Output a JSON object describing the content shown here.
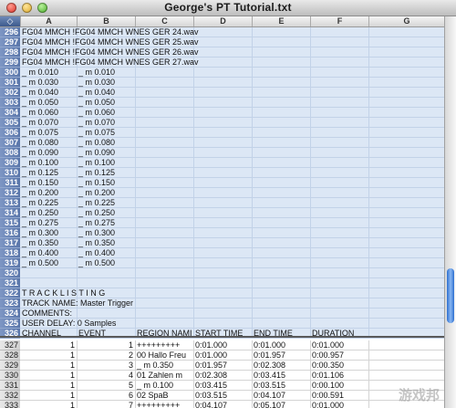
{
  "window": {
    "title": "George's PT Tutorial.txt"
  },
  "columns": [
    "A",
    "B",
    "C",
    "D",
    "E",
    "F",
    "G"
  ],
  "corner_symbol": "◇",
  "rows": [
    {
      "num": "296",
      "cells": [
        "FG04 MMCH !FG04 MMCH WNES GER 24.wav",
        "",
        "",
        "",
        "",
        "",
        ""
      ]
    },
    {
      "num": "297",
      "cells": [
        "FG04 MMCH !FG04 MMCH WNES GER 25.wav",
        "",
        "",
        "",
        "",
        "",
        ""
      ]
    },
    {
      "num": "298",
      "cells": [
        "FG04 MMCH !FG04 MMCH WNES GER 26.wav",
        "",
        "",
        "",
        "",
        "",
        ""
      ]
    },
    {
      "num": "299",
      "cells": [
        "FG04 MMCH !FG04 MMCH WNES GER 27.wav",
        "",
        "",
        "",
        "",
        "",
        ""
      ]
    },
    {
      "num": "300",
      "cells": [
        "_ m 0.010",
        "_ m 0.010",
        "",
        "",
        "",
        "",
        ""
      ]
    },
    {
      "num": "301",
      "cells": [
        "_ m 0.030",
        "_ m 0.030",
        "",
        "",
        "",
        "",
        ""
      ]
    },
    {
      "num": "302",
      "cells": [
        "_ m 0.040",
        "_ m 0.040",
        "",
        "",
        "",
        "",
        ""
      ]
    },
    {
      "num": "303",
      "cells": [
        "_ m 0.050",
        "_ m 0.050",
        "",
        "",
        "",
        "",
        ""
      ]
    },
    {
      "num": "304",
      "cells": [
        "_ m 0.060",
        "_ m 0.060",
        "",
        "",
        "",
        "",
        ""
      ]
    },
    {
      "num": "305",
      "cells": [
        "_ m 0.070",
        "_ m 0.070",
        "",
        "",
        "",
        "",
        ""
      ]
    },
    {
      "num": "306",
      "cells": [
        "_ m 0.075",
        "_ m 0.075",
        "",
        "",
        "",
        "",
        ""
      ]
    },
    {
      "num": "307",
      "cells": [
        "_ m 0.080",
        "_ m 0.080",
        "",
        "",
        "",
        "",
        ""
      ]
    },
    {
      "num": "308",
      "cells": [
        "_ m 0.090",
        "_ m 0.090",
        "",
        "",
        "",
        "",
        ""
      ]
    },
    {
      "num": "309",
      "cells": [
        "_ m 0.100",
        "_ m 0.100",
        "",
        "",
        "",
        "",
        ""
      ]
    },
    {
      "num": "310",
      "cells": [
        "_ m 0.125",
        "_ m 0.125",
        "",
        "",
        "",
        "",
        ""
      ]
    },
    {
      "num": "311",
      "cells": [
        "_ m 0.150",
        "_ m 0.150",
        "",
        "",
        "",
        "",
        ""
      ]
    },
    {
      "num": "312",
      "cells": [
        "_ m 0.200",
        "_ m 0.200",
        "",
        "",
        "",
        "",
        ""
      ]
    },
    {
      "num": "313",
      "cells": [
        "_ m 0.225",
        "_ m 0.225",
        "",
        "",
        "",
        "",
        ""
      ]
    },
    {
      "num": "314",
      "cells": [
        "_ m 0.250",
        "_ m 0.250",
        "",
        "",
        "",
        "",
        ""
      ]
    },
    {
      "num": "315",
      "cells": [
        "_ m 0.275",
        "_ m 0.275",
        "",
        "",
        "",
        "",
        ""
      ]
    },
    {
      "num": "316",
      "cells": [
        "_ m 0.300",
        "_ m 0.300",
        "",
        "",
        "",
        "",
        ""
      ]
    },
    {
      "num": "317",
      "cells": [
        "_ m 0.350",
        "_ m 0.350",
        "",
        "",
        "",
        "",
        ""
      ]
    },
    {
      "num": "318",
      "cells": [
        "_ m 0.400",
        "_ m 0.400",
        "",
        "",
        "",
        "",
        ""
      ]
    },
    {
      "num": "319",
      "cells": [
        "_ m 0.500",
        "_ m 0.500",
        "",
        "",
        "",
        "",
        ""
      ]
    },
    {
      "num": "320",
      "cells": [
        "",
        "",
        "",
        "",
        "",
        "",
        ""
      ]
    },
    {
      "num": "321",
      "cells": [
        "",
        "",
        "",
        "",
        "",
        "",
        ""
      ]
    },
    {
      "num": "322",
      "cells": [
        "T R A C K   L I S T I N G",
        "",
        "",
        "",
        "",
        "",
        ""
      ]
    },
    {
      "num": "323",
      "cells": [
        "TRACK NAME: Master Trigger",
        "",
        "",
        "",
        "",
        "",
        ""
      ]
    },
    {
      "num": "324",
      "cells": [
        "COMMENTS:",
        "",
        "",
        "",
        "",
        "",
        ""
      ]
    },
    {
      "num": "325",
      "cells": [
        "USER DELAY: 0 Samples",
        "",
        "",
        "",
        "",
        "",
        ""
      ]
    },
    {
      "num": "326",
      "cells": [
        "CHANNEL",
        "EVENT",
        "REGION NAMI",
        "START TIME",
        "END TIME",
        "DURATION",
        ""
      ]
    },
    {
      "num": "327",
      "cells": [
        "1",
        "1",
        "+++++++++",
        "0:01.000",
        "0:01.000",
        "0:01.000",
        ""
      ]
    },
    {
      "num": "328",
      "cells": [
        "1",
        "2",
        "00 Hallo Freu",
        "0:01.000",
        "0:01.957",
        "0:00.957",
        ""
      ]
    },
    {
      "num": "329",
      "cells": [
        "1",
        "3",
        "_ m 0.350",
        "0:01.957",
        "0:02.308",
        "0:00.350",
        ""
      ]
    },
    {
      "num": "330",
      "cells": [
        "1",
        "4",
        "01 Zahlen m",
        "0:02.308",
        "0:03.415",
        "0:01.106",
        ""
      ]
    },
    {
      "num": "331",
      "cells": [
        "1",
        "5",
        "_ m 0.100",
        "0:03.415",
        "0:03.515",
        "0:00.100",
        ""
      ]
    },
    {
      "num": "332",
      "cells": [
        "1",
        "6",
        "02 SpaB",
        "0:03.515",
        "0:04.107",
        "0:00.591",
        ""
      ]
    },
    {
      "num": "333",
      "cells": [
        "1",
        "7",
        "+++++++++",
        "0:04.107",
        "0:05.107",
        "0:01.000",
        ""
      ]
    }
  ],
  "watermark": "游戏邦"
}
